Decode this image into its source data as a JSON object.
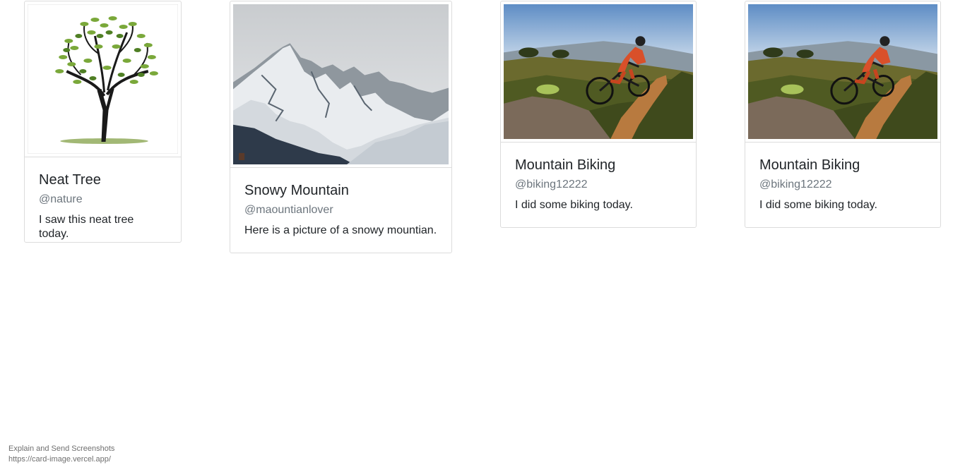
{
  "cards": [
    {
      "title": "Neat Tree",
      "handle": "@nature",
      "text": "I saw this neat tree today.",
      "image": "tree-illustration"
    },
    {
      "title": "Snowy Mountain",
      "handle": "@maountianlover",
      "text": "Here is a picture of a snowy mountian.",
      "image": "snowy-mountain-photo"
    },
    {
      "title": "Mountain Biking",
      "handle": "@biking12222",
      "text": "I did some biking today.",
      "image": "mountain-biker-photo"
    },
    {
      "title": "Mountain Biking",
      "handle": "@biking12222",
      "text": "I did some biking today.",
      "image": "mountain-biker-photo"
    }
  ],
  "overlay": {
    "label": "Explain and Send Screenshots",
    "url": "https://card-image.vercel.app/"
  }
}
